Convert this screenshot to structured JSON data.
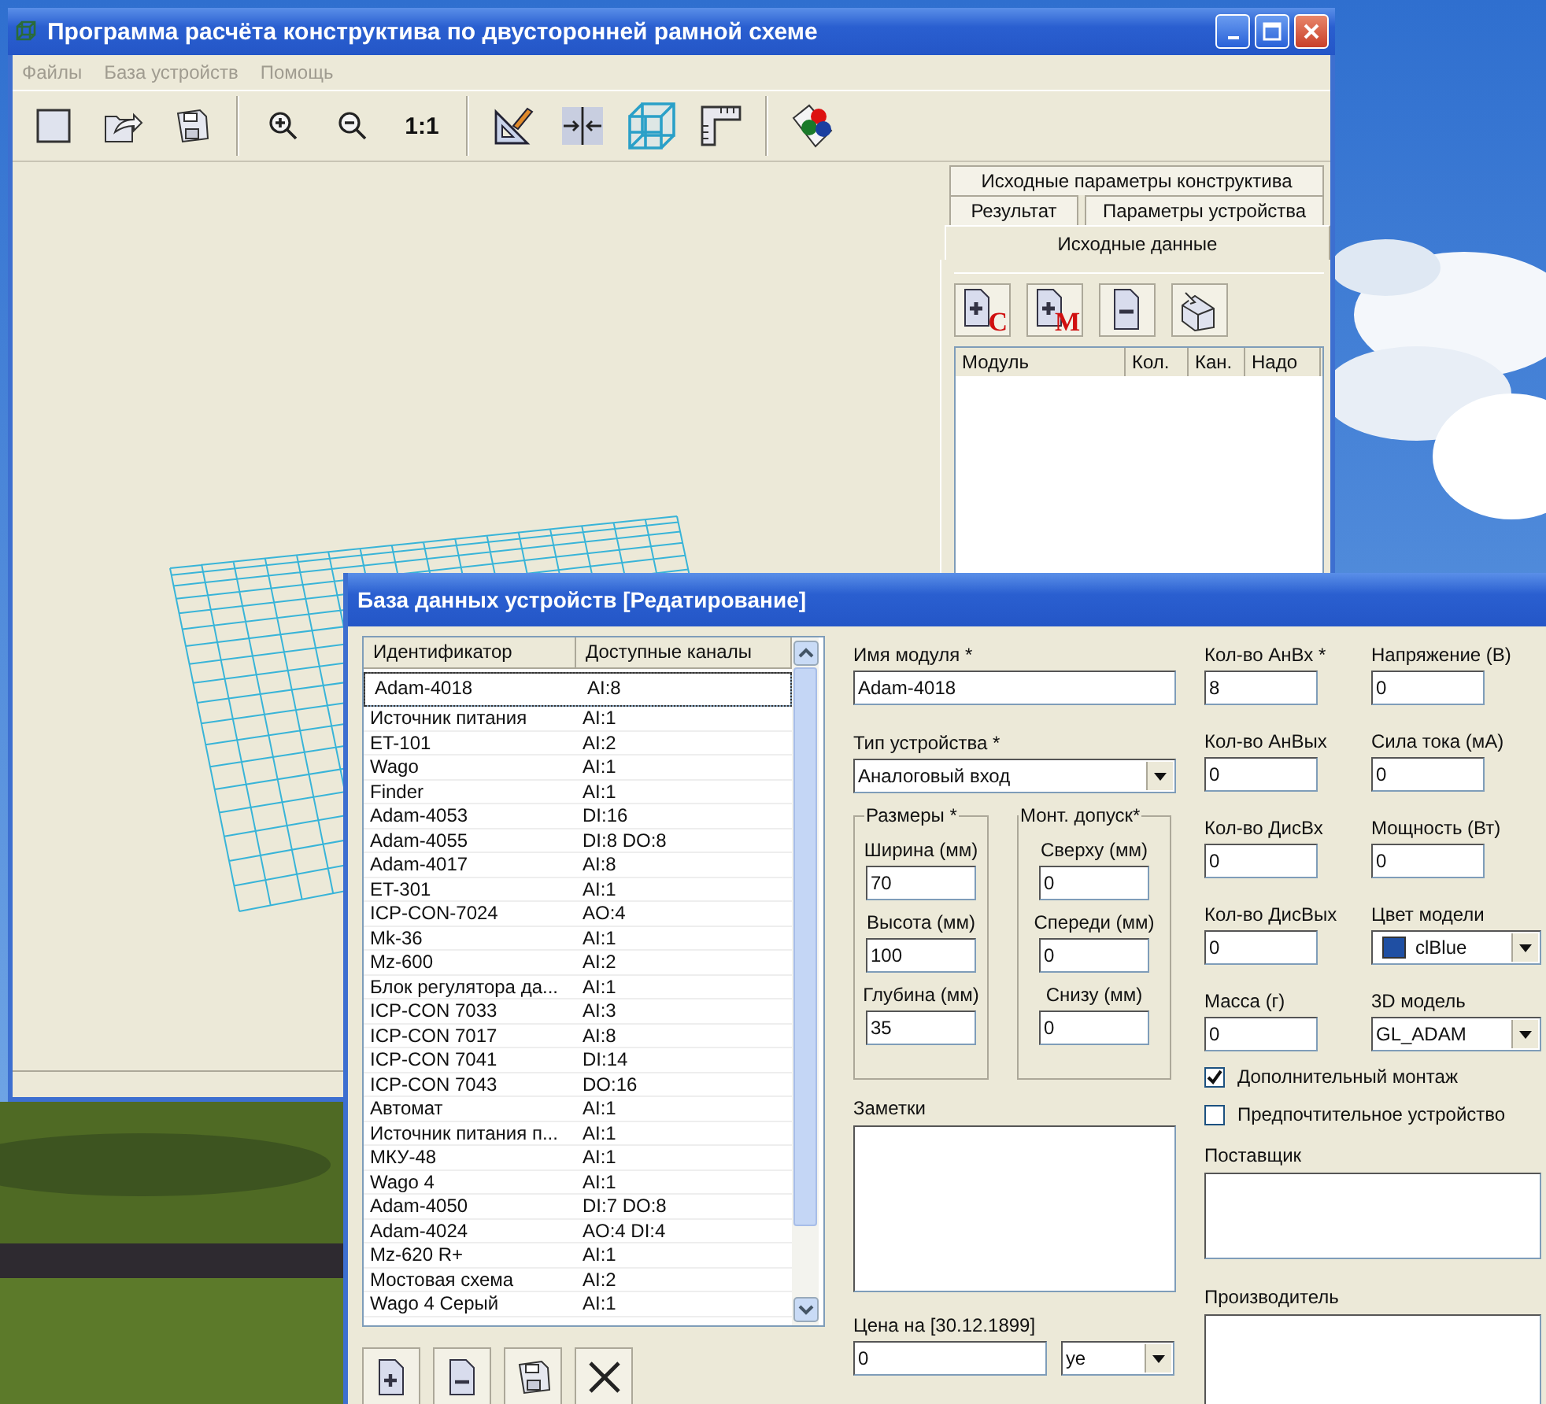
{
  "main_window": {
    "title": "Программа расчёта конструктива по двусторонней рамной схеме",
    "menu": [
      "Файлы",
      "База устройств",
      "Помощь"
    ],
    "zoom_label": "1:1",
    "side_panel": {
      "tab_rows": [
        [
          {
            "label": "Исходные параметры конструктива",
            "selected": false
          }
        ],
        [
          {
            "label": "Результат",
            "selected": false
          },
          {
            "label": "Параметры устройства",
            "selected": false
          }
        ],
        [
          {
            "label": "Исходные данные",
            "selected": true
          }
        ]
      ],
      "buttons": [
        {
          "kind": "add",
          "letter": "С"
        },
        {
          "kind": "add",
          "letter": "М"
        },
        {
          "kind": "remove"
        },
        {
          "kind": "import"
        }
      ],
      "columns": [
        "Модуль",
        "Кол.",
        "Кан.",
        "Надо"
      ]
    }
  },
  "dialog": {
    "title": "База данных устройств [Редатирование]",
    "list": {
      "columns": [
        "Идентификатор",
        "Доступные каналы"
      ],
      "rows": [
        {
          "id": "Adam-4018",
          "channels": "AI:8",
          "selected": true
        },
        {
          "id": "Источник питания",
          "channels": "AI:1",
          "selected": false
        },
        {
          "id": "ET-101",
          "channels": "AI:2",
          "selected": false
        },
        {
          "id": "Wago",
          "channels": "AI:1",
          "selected": false
        },
        {
          "id": "Finder",
          "channels": "AI:1",
          "selected": false
        },
        {
          "id": "Adam-4053",
          "channels": "DI:16",
          "selected": false
        },
        {
          "id": "Adam-4055",
          "channels": "DI:8 DO:8",
          "selected": false
        },
        {
          "id": "Adam-4017",
          "channels": "AI:8",
          "selected": false
        },
        {
          "id": "ET-301",
          "channels": "AI:1",
          "selected": false
        },
        {
          "id": "ICP-CON-7024",
          "channels": "AO:4",
          "selected": false
        },
        {
          "id": "Mk-36",
          "channels": "AI:1",
          "selected": false
        },
        {
          "id": "Mz-600",
          "channels": "AI:2",
          "selected": false
        },
        {
          "id": "Блок регулятора да...",
          "channels": "AI:1",
          "selected": false
        },
        {
          "id": "ICP-CON 7033",
          "channels": "AI:3",
          "selected": false
        },
        {
          "id": "ICP-CON 7017",
          "channels": "AI:8",
          "selected": false
        },
        {
          "id": "ICP-CON 7041",
          "channels": "DI:14",
          "selected": false
        },
        {
          "id": "ICP-CON 7043",
          "channels": "DO:16",
          "selected": false
        },
        {
          "id": "Автомат",
          "channels": "AI:1",
          "selected": false
        },
        {
          "id": "Источник питания п...",
          "channels": "AI:1",
          "selected": false
        },
        {
          "id": "МКУ-48",
          "channels": "AI:1",
          "selected": false
        },
        {
          "id": "Wago 4",
          "channels": "AI:1",
          "selected": false
        },
        {
          "id": "Adam-4050",
          "channels": "DI:7 DO:8",
          "selected": false
        },
        {
          "id": "Adam-4024",
          "channels": "AO:4 DI:4",
          "selected": false
        },
        {
          "id": "Mz-620 R+",
          "channels": "AI:1",
          "selected": false
        },
        {
          "id": "Мостовая схема",
          "channels": "AI:2",
          "selected": false
        },
        {
          "id": "Wago 4 Серый",
          "channels": "AI:1",
          "selected": false
        }
      ]
    },
    "module_name": {
      "label": "Имя модуля *",
      "value": "Adam-4018"
    },
    "device_type": {
      "label": "Тип устройства *",
      "value": "Аналоговый вход"
    },
    "sizes": {
      "title": "Размеры *",
      "fields": [
        {
          "label": "Ширина (мм)",
          "value": "70"
        },
        {
          "label": "Высота (мм)",
          "value": "100"
        },
        {
          "label": "Глубина (мм)",
          "value": "35"
        }
      ]
    },
    "mount": {
      "title": "Монт. допуск*",
      "fields": [
        {
          "label": "Сверху (мм)",
          "value": "0"
        },
        {
          "label": "Спереди (мм)",
          "value": "0"
        },
        {
          "label": "Снизу (мм)",
          "value": "0"
        }
      ]
    },
    "notes": {
      "label": "Заметки"
    },
    "price": {
      "label": "Цена на [30.12.1899]",
      "value": "0",
      "currency": "уе"
    },
    "grid": [
      {
        "kind": "input",
        "label": "Кол-во АнВх *",
        "value": "8"
      },
      {
        "kind": "input",
        "label": "Напряжение (В)",
        "value": "0"
      },
      {
        "kind": "input",
        "label": "Кол-во АнВых",
        "value": "0"
      },
      {
        "kind": "input",
        "label": "Сила тока (мА)",
        "value": "0"
      },
      {
        "kind": "input",
        "label": "Кол-во ДисВх",
        "value": "0"
      },
      {
        "kind": "input",
        "label": "Мощность (Вт)",
        "value": "0"
      },
      {
        "kind": "input",
        "label": "Кол-во ДисВых",
        "value": "0"
      },
      {
        "kind": "color_select",
        "label": "Цвет модели",
        "value": "clBlue",
        "color": "#1f4fa3"
      },
      {
        "kind": "input",
        "label": "Масса (г)",
        "value": "0"
      },
      {
        "kind": "select",
        "label": "3D модель",
        "value": "GL_ADAM"
      }
    ],
    "options": [
      {
        "label": "Дополнительный монтаж",
        "checked": true
      },
      {
        "label": "Предпочтительное устройство",
        "checked": false
      }
    ],
    "supplier": {
      "label": "Поставщик"
    },
    "manufacturer": {
      "label": "Производитель"
    }
  }
}
